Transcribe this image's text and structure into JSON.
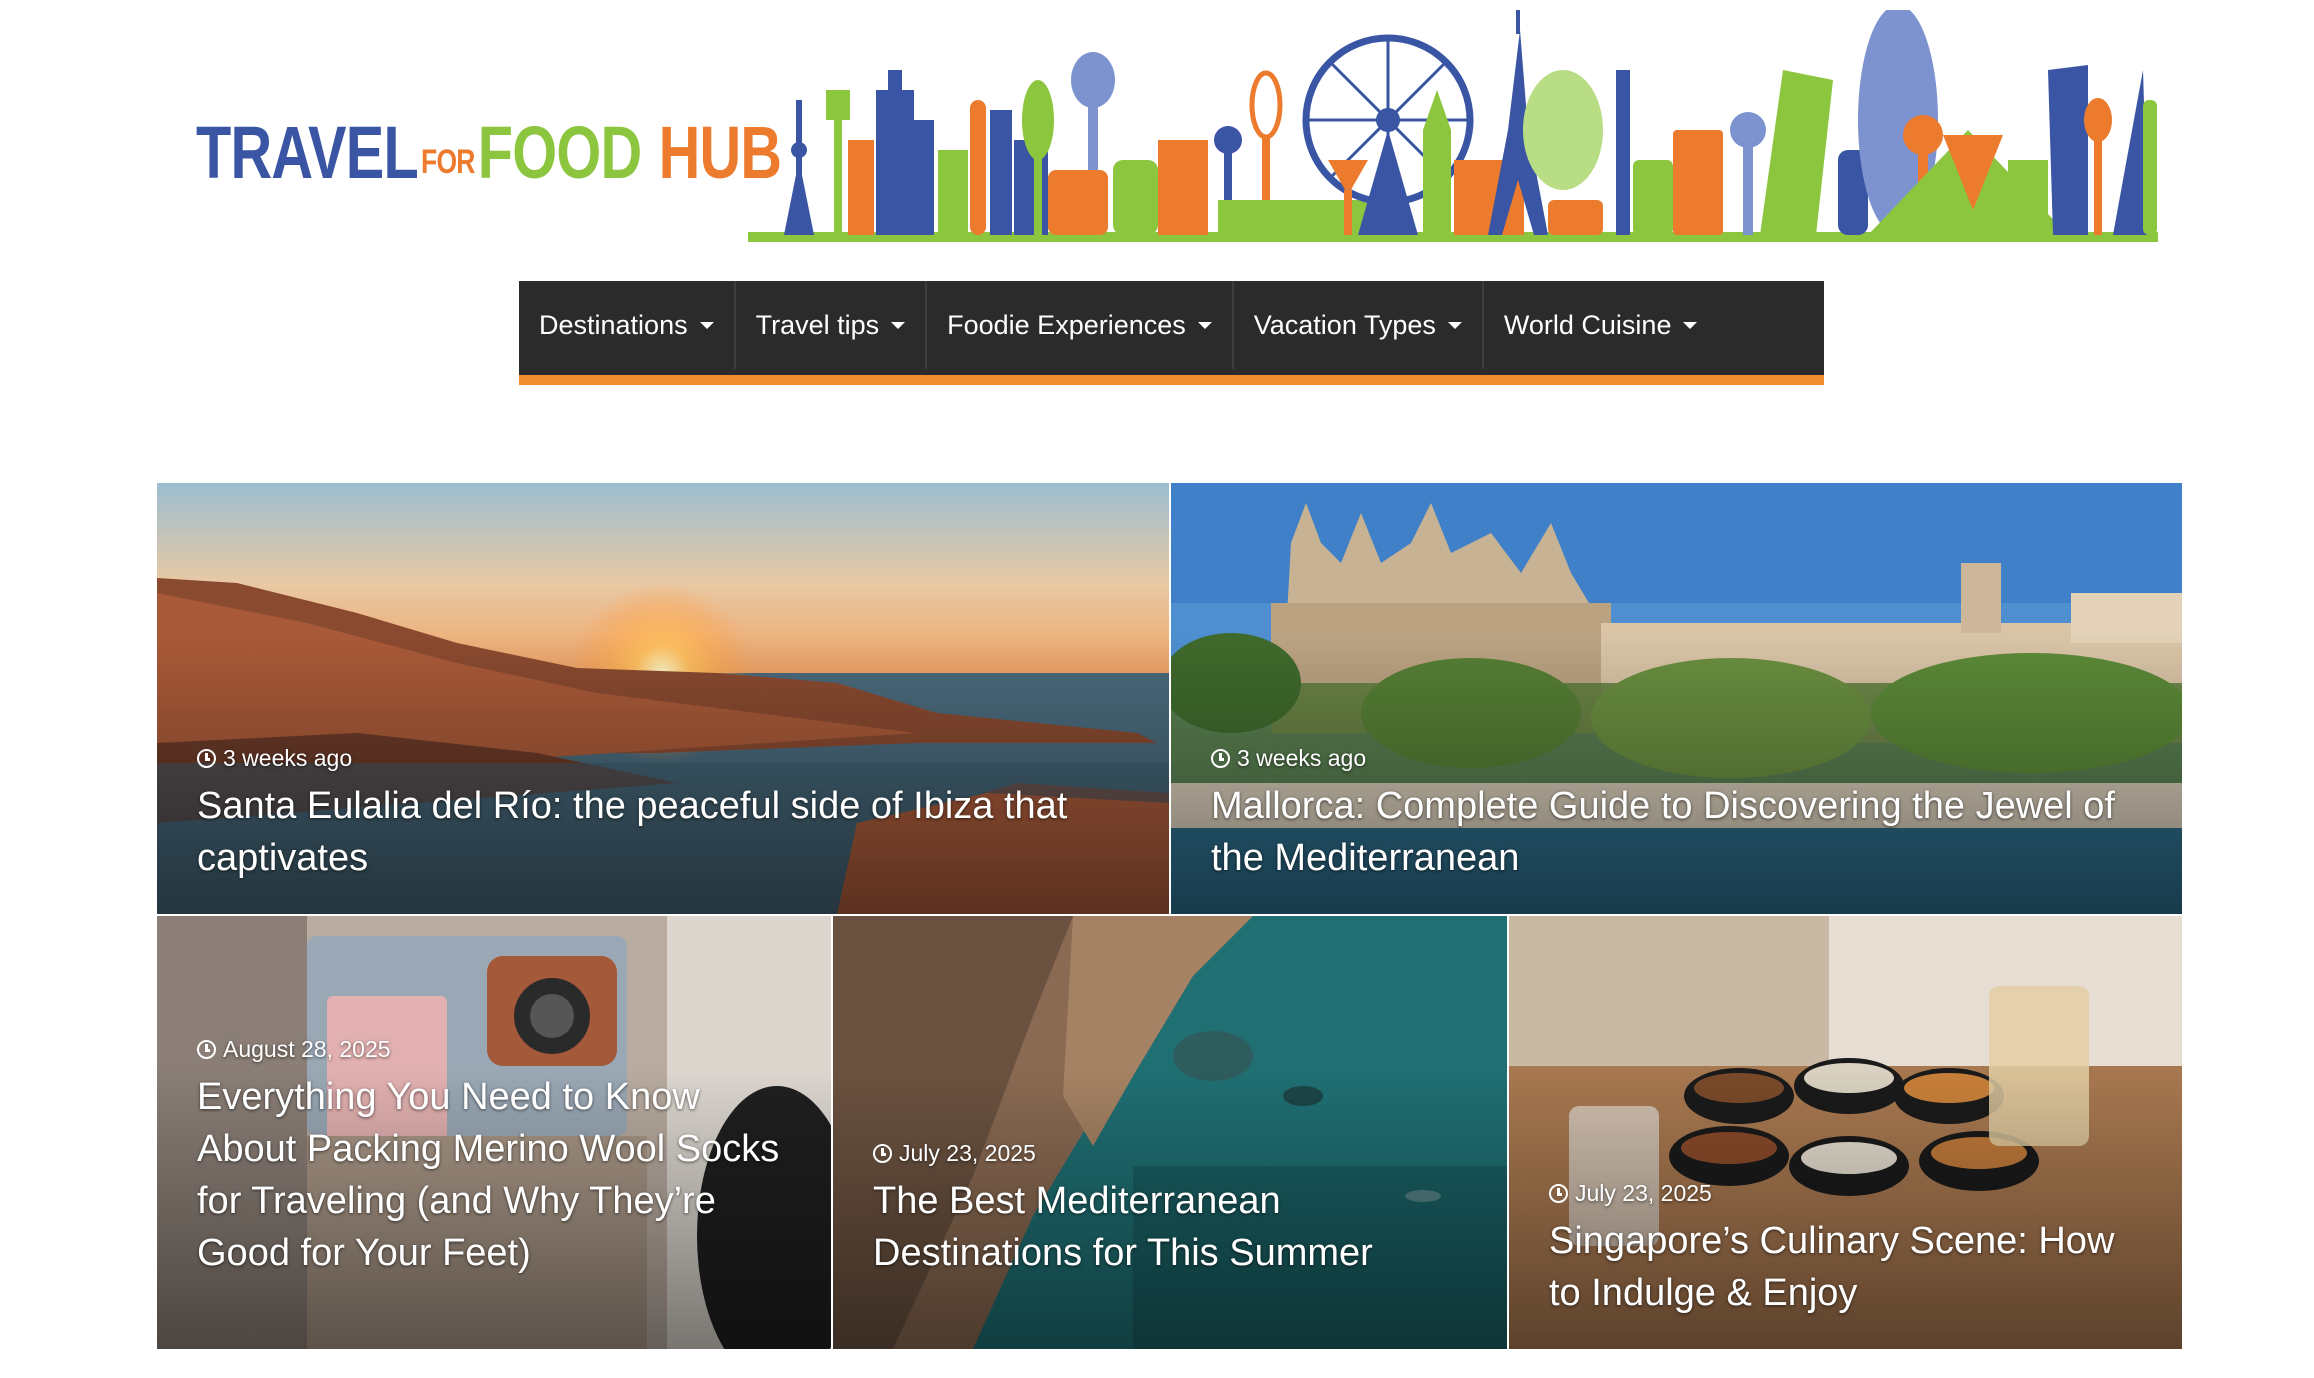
{
  "logo": {
    "part1": "TRAVEL",
    "part2": "FOR",
    "part3": "FOOD",
    "part4": "HUB"
  },
  "colors": {
    "blue": "#3a55a4",
    "orange": "#ec7b2d",
    "green": "#8cc63f",
    "nav_bg": "#2b2b2b",
    "nav_accent": "#ef8d2f"
  },
  "nav": {
    "items": [
      {
        "label": "Destinations"
      },
      {
        "label": "Travel tips"
      },
      {
        "label": "Foodie Experiences"
      },
      {
        "label": "Vacation Types"
      },
      {
        "label": "World Cuisine"
      }
    ]
  },
  "posts": [
    {
      "date": "3 weeks ago",
      "title": "Santa Eulalia del Río: the peaceful side of Ibiza that captivates"
    },
    {
      "date": "3 weeks ago",
      "title": "Mallorca: Complete Guide to Discovering the Jewel of the Mediterranean"
    },
    {
      "date": "August 28, 2025",
      "title": "Everything You Need to Know About Packing Merino Wool Socks for Traveling (and Why They’re Good for Your Feet)"
    },
    {
      "date": "July 23, 2025",
      "title": "The Best Mediterranean Destinations for This Summer"
    },
    {
      "date": "July 23, 2025",
      "title": "Singapore’s Culinary Scene: How to Indulge & Enjoy"
    }
  ]
}
